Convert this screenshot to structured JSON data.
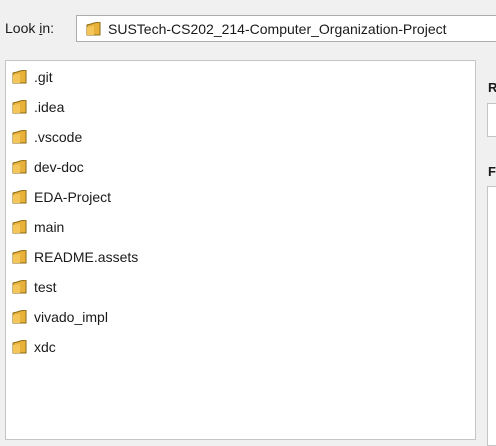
{
  "look_in": {
    "label_before": "Look ",
    "label_mnemonic": "i",
    "label_after": "n:",
    "path": "SUSTech-CS202_214-Computer_Organization-Project"
  },
  "file_list": {
    "items": [
      {
        "name": ".git",
        "icon": "folder-icon"
      },
      {
        "name": ".idea",
        "icon": "folder-icon"
      },
      {
        "name": ".vscode",
        "icon": "folder-icon"
      },
      {
        "name": "dev-doc",
        "icon": "folder-icon"
      },
      {
        "name": "EDA-Project",
        "icon": "folder-icon"
      },
      {
        "name": "main",
        "icon": "folder-icon"
      },
      {
        "name": "README.assets",
        "icon": "folder-icon"
      },
      {
        "name": "test",
        "icon": "folder-icon"
      },
      {
        "name": "vivado_impl",
        "icon": "folder-icon"
      },
      {
        "name": "xdc",
        "icon": "folder-icon"
      }
    ]
  },
  "right_panel": {
    "label_1": "R",
    "label_2": "F"
  },
  "colors": {
    "background": "#f0f0f0",
    "folder_yellow": "#e8b23a",
    "folder_dark": "#8a6a16"
  }
}
